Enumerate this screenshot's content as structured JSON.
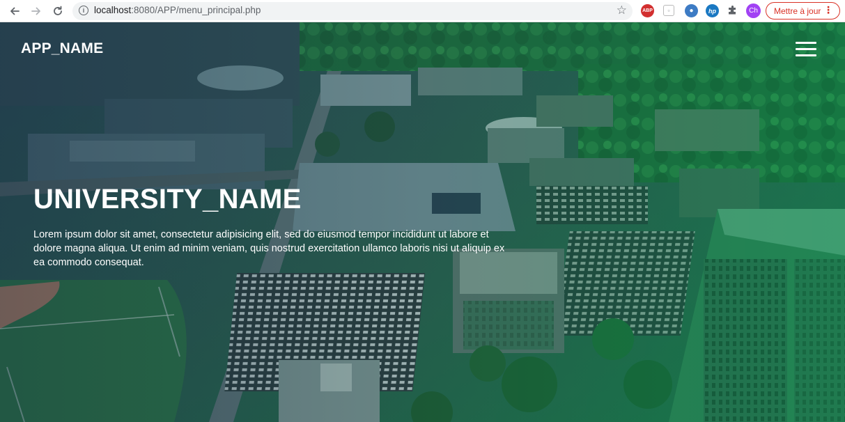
{
  "browser": {
    "url_host": "localhost",
    "url_path": ":8080/APP/menu_principal.php",
    "extensions": {
      "abp": "ABP",
      "hp": "hp",
      "profile": "Ch"
    },
    "update_label": "Mettre à jour"
  },
  "navbar": {
    "brand": "APP_NAME"
  },
  "hero": {
    "title": "UNIVERSITY_NAME",
    "text": "Lorem ipsum dolor sit amet, consectetur adipisicing elit, sed do eiusmod tempor incididunt ut labore et dolore magna aliqua. Ut enim ad minim veniam, quis nostrud exercitation ullamco laboris nisi ut aliquip ex ea commodo consequat."
  },
  "colors": {
    "update_accent": "#d93025",
    "overlay_tint": "#0a8c5a"
  },
  "icons": {
    "back": "arrow-left-icon",
    "forward": "arrow-right-icon",
    "reload": "reload-icon",
    "info": "info-icon",
    "bookmark": "star-icon",
    "extensions": "puzzle-icon",
    "menu": "hamburger-icon"
  }
}
